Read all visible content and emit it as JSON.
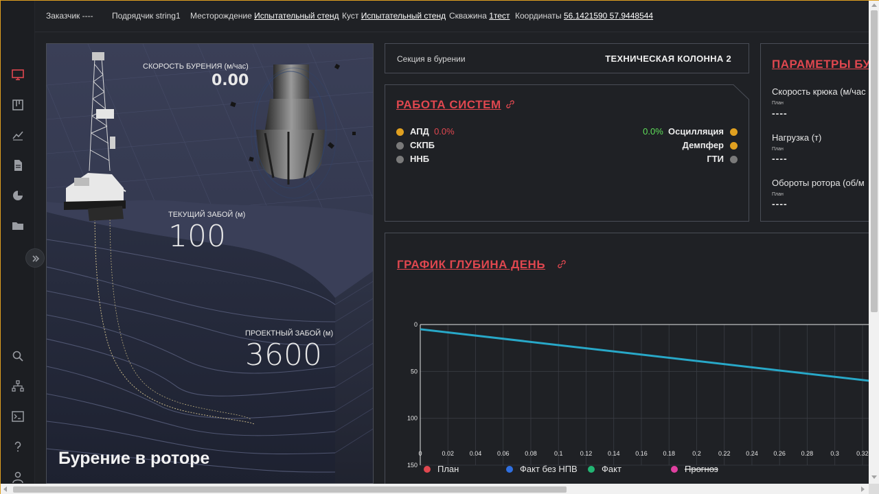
{
  "topbar": {
    "customer_label": "Заказчик",
    "customer_value": "----",
    "contractor_label": "Подрядчик",
    "contractor_value": "string1",
    "field_label": "Месторождение",
    "field_value": "Испытательный стенд",
    "pad_label": "Куст",
    "pad_value": "Испытательный стенд",
    "well_label": "Скважина",
    "well_value": "1тест",
    "coords_label": "Координаты",
    "coords_value": "56.1421590 57.9448544"
  },
  "sidebar": {
    "top_icons": [
      "monitor-icon",
      "board-icon",
      "chart-line-icon",
      "document-icon",
      "pie-icon",
      "folder-icon"
    ],
    "bottom_icons": [
      "search-icon",
      "hierarchy-icon",
      "terminal-icon",
      "help-icon",
      "user-icon"
    ],
    "active_color": "#e0474f"
  },
  "hero": {
    "speed_label": "СКОРОСТЬ БУРЕНИЯ (м/час)",
    "speed_value": "0.00",
    "current_depth_label": "ТЕКУЩИЙ ЗАБОЙ (м)",
    "current_depth_value": "100",
    "project_depth_label": "ПРОЕКТНЫЙ ЗАБОЙ (м)",
    "project_depth_value": "3600",
    "mode": "Бурение в роторе"
  },
  "section": {
    "label": "Секция в бурении",
    "value": "ТЕХНИЧЕСКАЯ КОЛОННА 2"
  },
  "systems": {
    "title": "РАБОТА СИСТЕМ",
    "left": [
      {
        "name": "АПД",
        "value": "0.0%",
        "status": "#e0a020"
      },
      {
        "name": "СКПБ",
        "value": "",
        "status": "#7a7a7a"
      },
      {
        "name": "ННБ",
        "value": "",
        "status": "#7a7a7a"
      }
    ],
    "right": [
      {
        "name": "Осцилляция",
        "value": "0.0%",
        "status": "#e0a020"
      },
      {
        "name": "Демпфер",
        "value": "",
        "status": "#e0a020"
      },
      {
        "name": "ГТИ",
        "value": "",
        "status": "#7a7a7a"
      }
    ]
  },
  "params": {
    "title": "ПАРАМЕТРЫ БУ",
    "items": [
      {
        "name": "Скорость крюка (м/час",
        "plan": "План",
        "value": "----"
      },
      {
        "name": "Нагрузка (т)",
        "plan": "План",
        "value": "----"
      },
      {
        "name": "Обороты ротора (об/м",
        "plan": "План",
        "value": "----"
      }
    ]
  },
  "chart": {
    "title": "ГРАФИК ГЛУБИНА ДЕНЬ",
    "legend": [
      {
        "name": "План",
        "color": "#e0474f"
      },
      {
        "name": "Факт без НПВ",
        "color": "#2f6fe0"
      },
      {
        "name": "Факт",
        "color": "#22b573"
      },
      {
        "name": "Прогноз",
        "color": "#e040a0"
      }
    ]
  },
  "chart_data": {
    "type": "line",
    "title": "ГРАФИК ГЛУБИНА ДЕНЬ",
    "x_ticks": [
      "0",
      "0.02",
      "0.04",
      "0.06",
      "0.08",
      "0.1",
      "0.12",
      "0.14",
      "0.16",
      "0.18",
      "0.2",
      "0.22",
      "0.24",
      "0.26",
      "0.28",
      "0.3",
      "0.32"
    ],
    "y_ticks": [
      "0",
      "50",
      "100",
      "150"
    ],
    "xlim": [
      0,
      0.325
    ],
    "ylim": [
      0,
      150
    ],
    "y_inverted": true,
    "grid": true,
    "legend_position": "bottom",
    "series": [
      {
        "name": "План",
        "color": "#28a8c8",
        "x": [
          0,
          0.325
        ],
        "y": [
          5,
          60
        ]
      }
    ]
  }
}
